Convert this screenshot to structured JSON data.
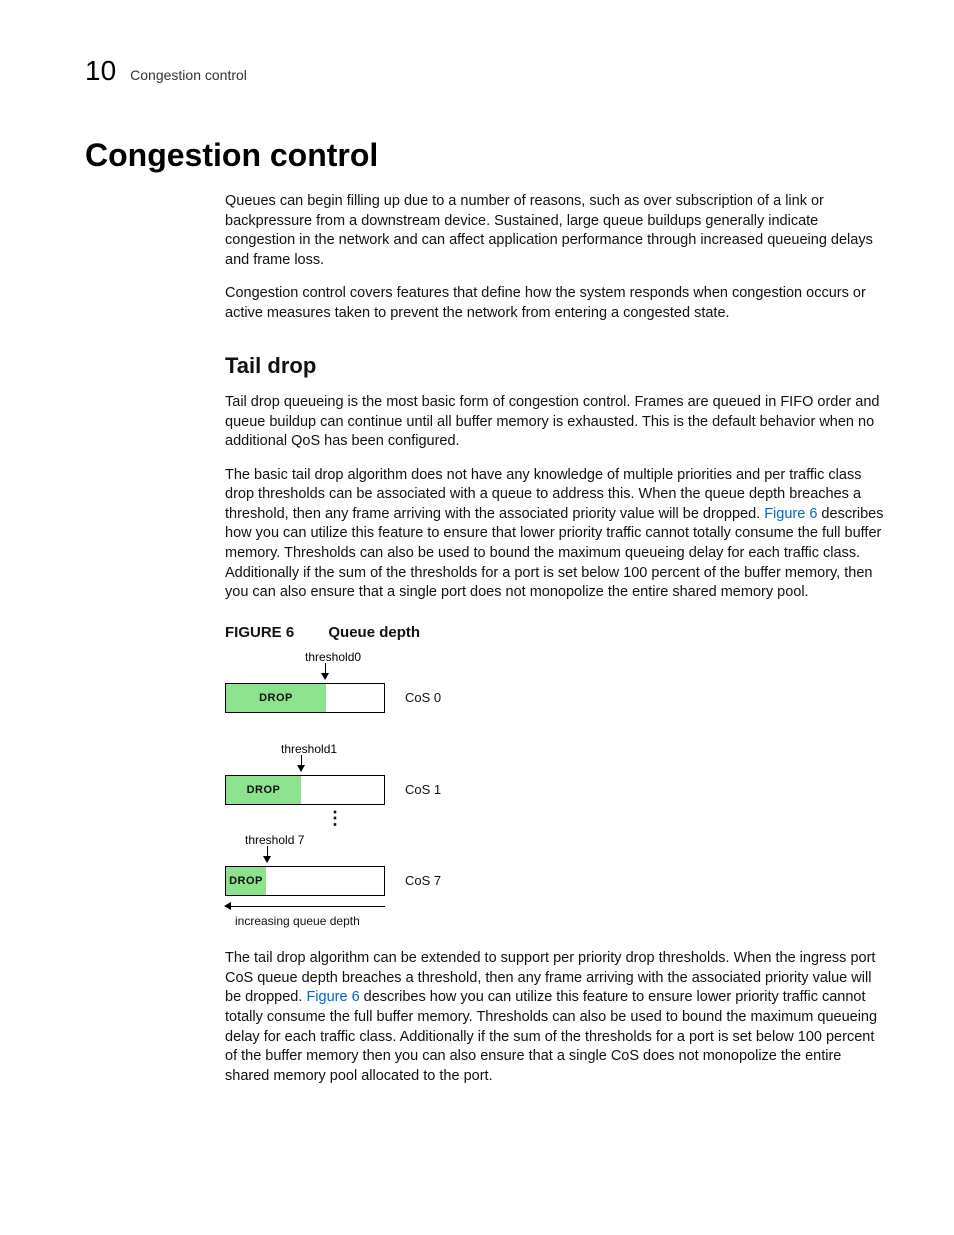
{
  "header": {
    "chapter_number": "10",
    "chapter_title": "Congestion control"
  },
  "h1": "Congestion control",
  "intro_p1": "Queues can begin filling up due to a number of reasons, such as over subscription of a link or backpressure from a downstream device. Sustained, large queue buildups generally indicate congestion in the network and can affect application performance through increased queueing delays and frame loss.",
  "intro_p2": "Congestion control covers features that define how the system responds when congestion occurs or active measures taken to prevent the network from entering a congested state.",
  "h2": "Tail drop",
  "tail_p1": "Tail drop queueing is the most basic form of congestion control. Frames are queued in FIFO order and queue buildup can continue until all buffer memory is exhausted. This is the default behavior when no additional QoS has been configured.",
  "tail_p2_a": "The basic tail drop algorithm does not have any knowledge of multiple priorities and per traffic class drop thresholds can be associated with a queue to address this. When the queue depth breaches a threshold, then any frame arriving with the associated priority value will be dropped. ",
  "tail_p2_link": "Figure 6",
  "tail_p2_b": " describes how you can utilize this feature to ensure that lower priority traffic cannot totally consume the full buffer memory. Thresholds can also be used to bound the maximum queueing delay for each traffic class. Additionally if the sum of the thresholds for a port is set below 100 percent of the buffer memory, then you can also ensure that a single port does not monopolize the entire shared memory pool.",
  "figure": {
    "label": "FIGURE 6",
    "title": "Queue depth",
    "rows": [
      {
        "threshold": "threshold0",
        "cos": "CoS 0",
        "drop": "DROP",
        "drop_width": 100
      },
      {
        "threshold": "threshold1",
        "cos": "CoS 1",
        "drop": "DROP",
        "drop_width": 75
      },
      {
        "threshold": "threshold 7",
        "cos": "CoS 7",
        "drop": "DROP",
        "drop_width": 40
      }
    ],
    "xaxis": "increasing queue depth"
  },
  "tail_p3_a": "The tail drop algorithm can be extended to support per priority drop thresholds. When the ingress port CoS queue depth breaches a threshold, then any frame arriving with the associated priority value will be dropped. ",
  "tail_p3_link": "Figure 6",
  "tail_p3_b": " describes how you can utilize this feature to ensure lower priority traffic cannot totally consume the full buffer memory. Thresholds can also be used to bound the maximum queueing delay for each traffic class. Additionally if the sum of the thresholds for a port is set below 100 percent of the buffer memory then you can also ensure that a single CoS does not monopolize the entire shared memory pool allocated to the port."
}
